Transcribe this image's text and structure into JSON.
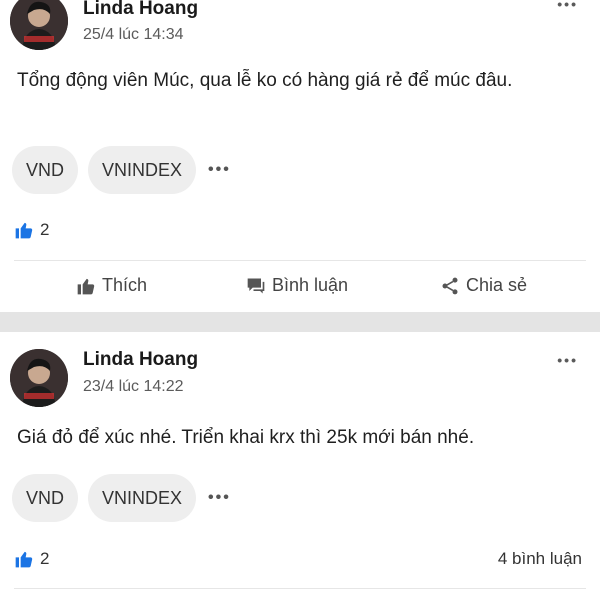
{
  "colors": {
    "accent_blue": "#1b74e4",
    "separator": "#e4e4e4",
    "chip_bg": "#eeeeee"
  },
  "posts": [
    {
      "author": "Linda Hoang",
      "time": "25/4 lúc 14:34",
      "content": "Tổng động viên Múc, qua lễ ko có hàng giá rẻ để múc đâu.",
      "tags": [
        "VND",
        "VNINDEX"
      ],
      "more_tags": "•••",
      "like_count": "2",
      "actions": {
        "like": "Thích",
        "comment": "Bình luận",
        "share": "Chia sẻ"
      }
    },
    {
      "author": "Linda Hoang",
      "time": "23/4 lúc 14:22",
      "content": "Giá đỏ để xúc nhé. Triển khai krx thì 25k mới bán nhé.",
      "tags": [
        "VND",
        "VNINDEX"
      ],
      "more_tags": "•••",
      "like_count": "2",
      "comment_count": "4 bình luận"
    }
  ],
  "icons": {
    "more": "more-horizontal-icon",
    "like": "thumbs-up-icon",
    "comment": "comment-icon",
    "share": "share-icon"
  }
}
